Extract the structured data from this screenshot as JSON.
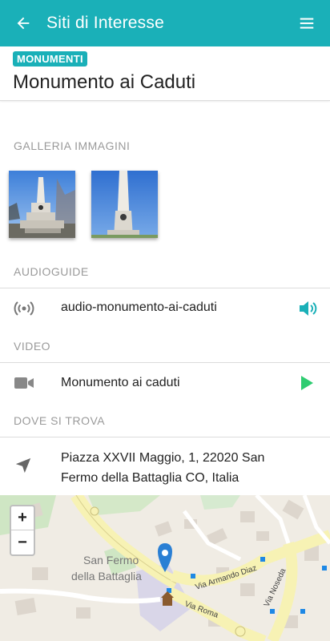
{
  "appbar": {
    "title": "Siti di Interesse",
    "back_icon": "arrow-left-icon",
    "menu_icon": "hamburger-menu-icon",
    "color": "#1ab0b8"
  },
  "header": {
    "category_badge": "MONUMENTI",
    "title": "Monumento ai Caduti"
  },
  "gallery": {
    "label": "GALLERIA IMMAGINI",
    "images": [
      "monument-photo-1",
      "monument-photo-2"
    ]
  },
  "audioguide": {
    "label": "AUDIOGUIDE",
    "item": "audio-monumento-ai-caduti",
    "icon": "broadcast-icon",
    "action_icon": "speaker-icon"
  },
  "video": {
    "label": "VIDEO",
    "item": "Monumento ai caduti",
    "icon": "video-camera-icon",
    "action_icon": "play-icon",
    "play_color": "#2ecc71"
  },
  "location": {
    "label": "DOVE SI TROVA",
    "address": "Piazza XXVII Maggio, 1, 22020 San Fermo della Battaglia CO, Italia",
    "icon": "navigation-arrow-icon"
  },
  "map": {
    "zoom_in": "+",
    "zoom_out": "−",
    "place_label_1": "San Fermo",
    "place_label_2": "della Battaglia",
    "streets": [
      "Via Armando Diaz",
      "Via Roma",
      "Via Noseda"
    ],
    "marker_color": "#2a7fd4"
  }
}
